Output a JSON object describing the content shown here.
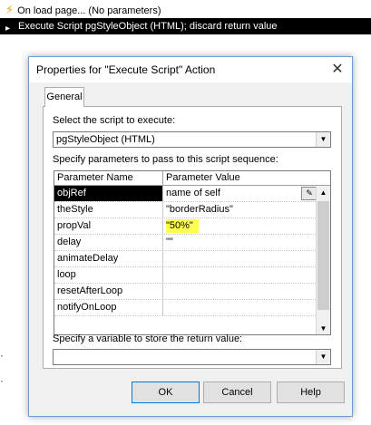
{
  "script_lines": {
    "line1": "On load page... (No parameters)",
    "line2": "Execute Script pgStyleObject (HTML); discard return value"
  },
  "dialog": {
    "title": "Properties for \"Execute Script\" Action",
    "tab": "General",
    "script_label": "Select the script to execute:",
    "script_value": "pgStyleObject (HTML)",
    "params_label": "Specify parameters to pass to this script sequence:",
    "columns": [
      "Parameter Name",
      "Parameter Value"
    ],
    "rows": [
      {
        "name": "objRef",
        "value": "name of self"
      },
      {
        "name": "theStyle",
        "value": "\"borderRadius\""
      },
      {
        "name": "propVal",
        "value": "\"50%\""
      },
      {
        "name": "delay",
        "value": "\"\""
      },
      {
        "name": "animateDelay",
        "value": ""
      },
      {
        "name": "loop",
        "value": ""
      },
      {
        "name": "resetAfterLoop",
        "value": ""
      },
      {
        "name": "notifyOnLoop",
        "value": ""
      }
    ],
    "return_label": "Specify a variable to store the return value:",
    "return_value": "",
    "ok": "OK",
    "cancel": "Cancel",
    "help": "Help"
  },
  "colors": {
    "highlight": "#ffff4d",
    "selection": "#000000",
    "accent": "#0078d7"
  }
}
